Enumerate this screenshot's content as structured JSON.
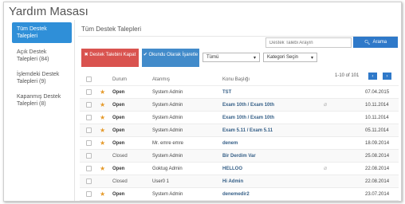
{
  "app": {
    "title": "Yardım Masası"
  },
  "sidebar": {
    "items": [
      {
        "label": "Tüm Destek Talepleri",
        "active": true
      },
      {
        "label": "Açık Destek Talepleri (84)",
        "active": false
      },
      {
        "label": "İşlemdeki Destek Talepleri (9)",
        "active": false
      },
      {
        "label": "Kapanmış Destek Talepleri (8)",
        "active": false
      }
    ]
  },
  "main": {
    "title": "Tüm Destek Talepleri",
    "search": {
      "placeholder": "Destek Talebi Arayın",
      "button_label": "Arama"
    },
    "actions": {
      "close_label": "Destek Talebini Kapat",
      "mark_read_label": "Okundu Olarak İşaretle"
    },
    "filters": {
      "status_value": "Tümü",
      "category_value": "Kategori Seçin"
    },
    "pagination": {
      "info": "1-10 of 101",
      "prev": "‹",
      "next": "›"
    },
    "table": {
      "headers": {
        "status": "Durum",
        "assignee": "Atanmış",
        "subject": "Konu Başlığı"
      },
      "rows": [
        {
          "status": "Open",
          "assignee": "System Admin",
          "subject": "TST",
          "date": "07.04.2015",
          "starred": true,
          "attachment": false
        },
        {
          "status": "Open",
          "assignee": "System Admin",
          "subject": "Exam 10th / Exam 10th",
          "date": "10.11.2014",
          "starred": true,
          "attachment": true
        },
        {
          "status": "Open",
          "assignee": "System Admin",
          "subject": "Exam 10th / Exam 10th",
          "date": "10.11.2014",
          "starred": true,
          "attachment": false
        },
        {
          "status": "Open",
          "assignee": "System Admin",
          "subject": "Exam 5.11 / Exam 5.11",
          "date": "05.11.2014",
          "starred": true,
          "attachment": false
        },
        {
          "status": "Open",
          "assignee": "Mr. emre emre",
          "subject": "denem",
          "date": "18.09.2014",
          "starred": true,
          "attachment": false
        },
        {
          "status": "Closed",
          "assignee": "System Admin",
          "subject": "Bir Derdim Var",
          "date": "25.08.2014",
          "starred": false,
          "attachment": false
        },
        {
          "status": "Open",
          "assignee": "Goktug Admin",
          "subject": "HELLOO",
          "date": "22.08.2014",
          "starred": true,
          "attachment": true
        },
        {
          "status": "Closed",
          "assignee": "User0 1",
          "subject": "Hi Admin",
          "date": "22.08.2014",
          "starred": false,
          "attachment": false
        },
        {
          "status": "Open",
          "assignee": "System Admin",
          "subject": "denemedir2",
          "date": "23.07.2014",
          "starred": true,
          "attachment": false
        }
      ]
    }
  }
}
